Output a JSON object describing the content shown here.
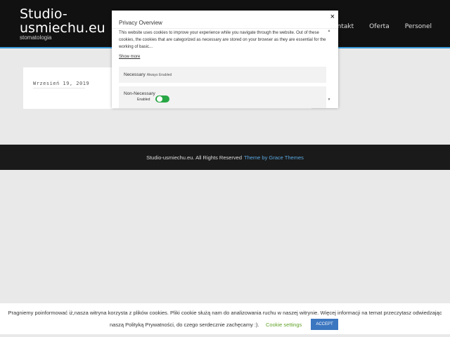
{
  "header": {
    "site_title_1": "Studio-",
    "site_title_2": "usmiechu.eu",
    "tagline": "stomatologia",
    "nav": {
      "contact_partial": "Kontakt",
      "offer": "Oferta",
      "staff": "Personel"
    }
  },
  "post": {
    "date": "Wrzesień 19, 2019"
  },
  "footer": {
    "copyright": "Studio-usmiechu.eu. All Rights Reserved",
    "theme_link": "Theme by Grace Themes"
  },
  "modal": {
    "close_glyph": "×",
    "title": "Privacy Overview",
    "body": "This website uses cookies to improve your experience while you navigate through the website. Out of these cookies, the cookies that are categorized as necessary are stored on your browser as they are essential for the working of basic...",
    "show_more": "Show more",
    "categories": [
      {
        "label": "Necessary",
        "status": "Always Enabled"
      },
      {
        "label": "Non-Necessary",
        "status": "Enabled"
      }
    ],
    "toggle_color": "#28a745"
  },
  "cookie_bar": {
    "line1": "Pragniemy poinformować iż,nasza witryna korzysta z plików cookies. Pliki cookie służą nam do analizowania ruchu w naszej witrynie. Więcej informacji na temat przeczytasz odwiedzając",
    "line2": "naszą Polityką Prywatności, do czego serdecznie zachęcamy :).",
    "settings": "Cookie settings",
    "accept": "ACCEPT",
    "accept_color": "#3b76c0"
  }
}
